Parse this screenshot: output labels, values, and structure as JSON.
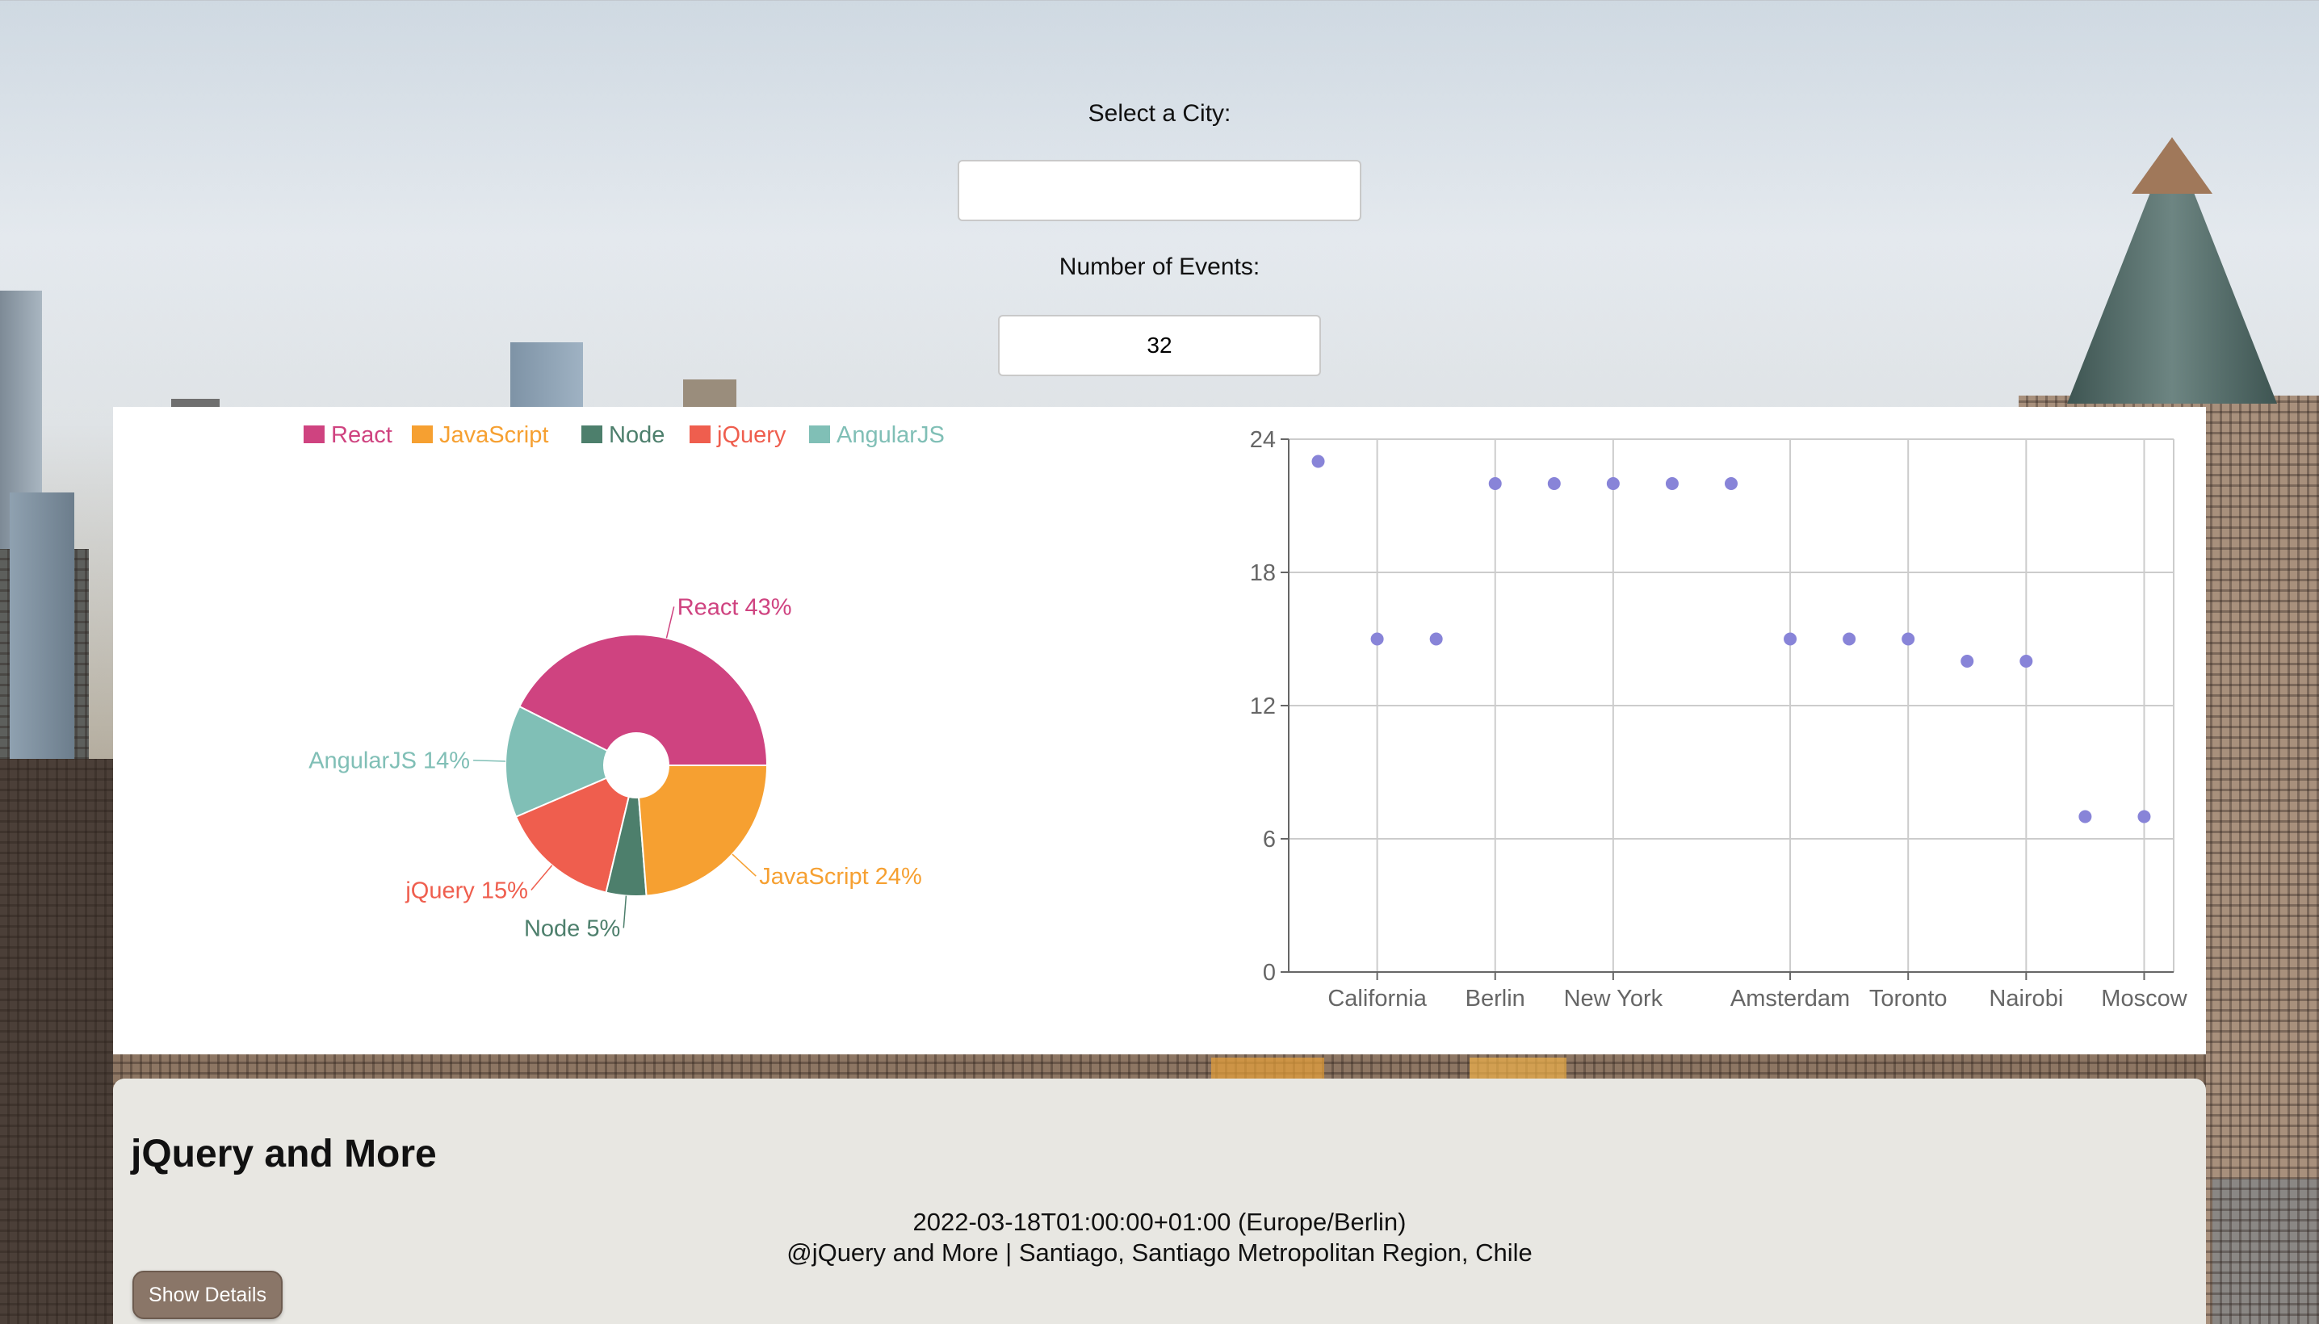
{
  "form": {
    "city_label": "Select a City:",
    "city_value": "",
    "events_label": "Number of Events:",
    "events_value": "32"
  },
  "pie_chart": {
    "chart_data": {
      "type": "pie",
      "legend_position": "top",
      "donut": true,
      "slices": [
        {
          "name": "React",
          "value": 43,
          "label": "React 43%",
          "color": "#cf4380"
        },
        {
          "name": "AngularJS",
          "value": 14,
          "label": "AngularJS 14%",
          "color": "#80bfb6"
        },
        {
          "name": "jQuery",
          "value": 15,
          "label": "jQuery 15%",
          "color": "#ef5e4e"
        },
        {
          "name": "Node",
          "value": 5,
          "label": "Node 5%",
          "color": "#4d7f6c"
        },
        {
          "name": "JavaScript",
          "value": 24,
          "label": "JavaScript 24%",
          "color": "#f6a031"
        }
      ],
      "legend": [
        "React",
        "JavaScript",
        "Node",
        "jQuery",
        "AngularJS"
      ]
    }
  },
  "scatter_chart": {
    "chart_data": {
      "type": "scatter",
      "color": "#8884d8",
      "grid": true,
      "ylim": [
        0,
        24
      ],
      "yticks": [
        "0",
        "6",
        "12",
        "18",
        "24"
      ],
      "x_tick_labels": [
        "California",
        "Berlin",
        "New York",
        "Amsterdam",
        "Toronto",
        "Nairobi",
        "Moscow"
      ],
      "x_tick_positions": [
        2,
        4,
        6,
        9,
        11,
        13,
        15
      ],
      "points": [
        {
          "x": 1,
          "y": 23
        },
        {
          "x": 2,
          "y": 15
        },
        {
          "x": 3,
          "y": 15
        },
        {
          "x": 4,
          "y": 22
        },
        {
          "x": 5,
          "y": 22
        },
        {
          "x": 6,
          "y": 22
        },
        {
          "x": 7,
          "y": 22
        },
        {
          "x": 8,
          "y": 22
        },
        {
          "x": 9,
          "y": 15
        },
        {
          "x": 10,
          "y": 15
        },
        {
          "x": 11,
          "y": 15
        },
        {
          "x": 12,
          "y": 14
        },
        {
          "x": 13,
          "y": 14
        },
        {
          "x": 14,
          "y": 7
        },
        {
          "x": 15,
          "y": 7
        }
      ]
    }
  },
  "event": {
    "title": "jQuery and More",
    "datetime": "2022-03-18T01:00:00+01:00 (Europe/Berlin)",
    "location": "@jQuery and More | Santiago, Santiago Metropolitan Region, Chile",
    "details_button": "Show Details"
  }
}
